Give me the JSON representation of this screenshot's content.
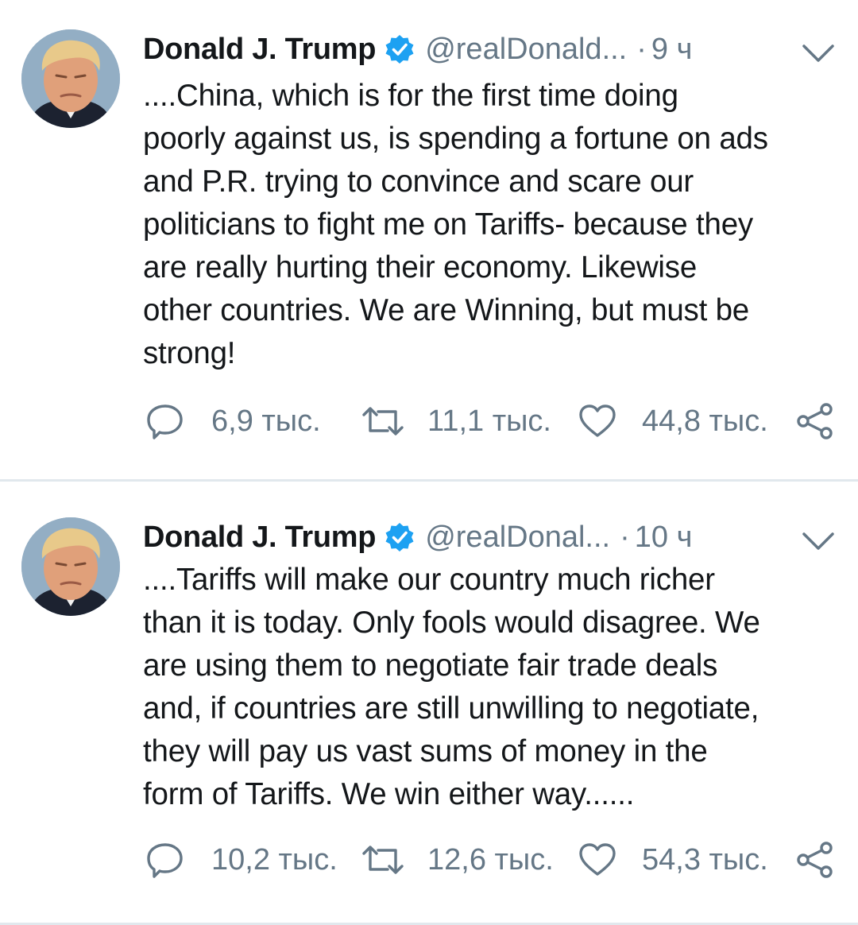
{
  "tweets": [
    {
      "name": "Donald J. Trump",
      "handle": "@realDonald...",
      "dot": "·",
      "time": "9 ч",
      "lines": [
        "....China, which is for the first time doing",
        "poorly against us, is spending a fortune on ads",
        "and P.R. trying to convince and scare our",
        "politicians to fight me on Tariffs- because they",
        "are really hurting their economy. Likewise",
        "other countries. We are Winning, but must be",
        "strong!"
      ],
      "replies": "6,9 тыс.",
      "retweets": "11,1 тыс.",
      "likes": "44,8 тыс."
    },
    {
      "name": "Donald J. Trump",
      "handle": "@realDonal...",
      "dot": "·",
      "time": "10 ч",
      "lines": [
        "....Tariffs will make our country much richer",
        "than it is today. Only fools would disagree. We",
        "are using them to negotiate fair trade deals",
        "and, if countries are still unwilling to negotiate,",
        "they will pay us vast sums of money in the",
        "form of Tariffs. We win either way......"
      ],
      "replies": "10,2 тыс.",
      "retweets": "12,6 тыс.",
      "likes": "54,3 тыс."
    }
  ],
  "icons": {
    "verified": "verified-badge-icon",
    "menu": "chevron-down-icon",
    "reply": "reply-icon",
    "retweet": "retweet-icon",
    "like": "heart-icon",
    "share": "share-icon"
  },
  "colors": {
    "verified": "#1da1f2",
    "secondary_text": "#657786",
    "divider": "#e1e8ed"
  }
}
